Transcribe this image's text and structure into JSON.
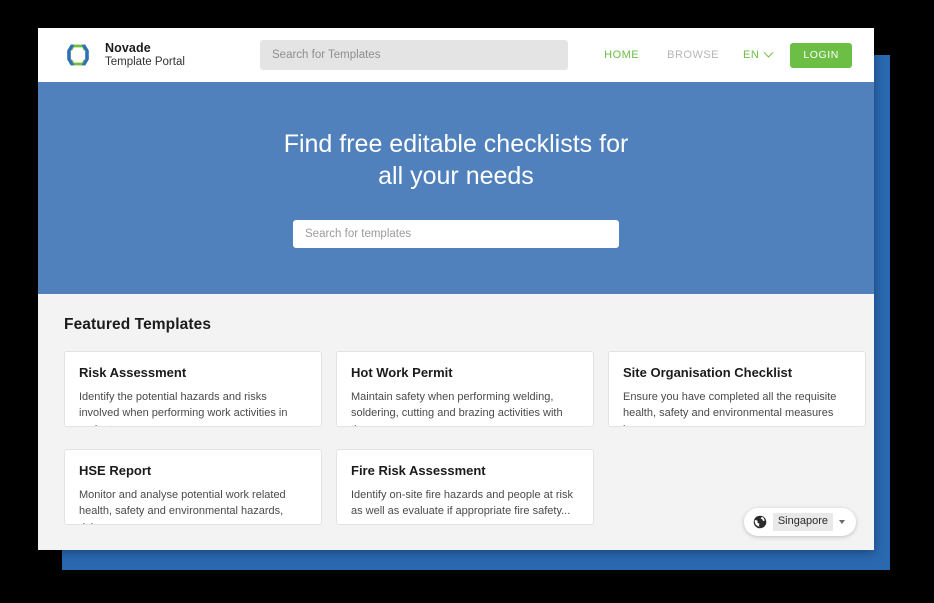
{
  "window": {
    "title": "Novade Template Portal"
  },
  "header": {
    "brand": {
      "name": "Novade",
      "subtitle": "Template Portal",
      "logo_icon": "novade-hexagon-logo",
      "logo_colors": {
        "blue": "#2e6fb7",
        "green": "#74bb44"
      }
    },
    "search": {
      "placeholder": "Search for Templates",
      "value": ""
    },
    "nav": [
      {
        "label": "HOME",
        "state": "active",
        "color": "#6cbe45"
      },
      {
        "label": "BROWSE",
        "state": "muted",
        "color": "#b6b6b6"
      }
    ],
    "language": {
      "label": "EN",
      "icon": "chevron-down-icon",
      "color": "#6cbe45"
    },
    "login_label": "LOGIN",
    "login_color": "#6cbe45"
  },
  "hero": {
    "background_color": "#5081bd",
    "title_line1": "Find free editable checklists for",
    "title_line2": "all your needs",
    "search": {
      "placeholder": "Search for templates",
      "value": ""
    }
  },
  "featured": {
    "heading": "Featured Templates",
    "background_color": "#f3f3f3",
    "cards": [
      {
        "title": "Risk Assessment",
        "description": "Identify the potential hazards and risks involved when performing work activities in projects an..."
      },
      {
        "title": "Hot Work Permit",
        "description": "Maintain safety when performing welding, soldering, cutting and brazing activities with th..."
      },
      {
        "title": "Site Organisation Checklist",
        "description": "Ensure you have completed all the requisite health, safety and environmental measures in..."
      },
      {
        "title": "HSE Report",
        "description": "Monitor and analyse potential work related health, safety and environmental hazards, risk..."
      },
      {
        "title": "Fire Risk Assessment",
        "description": "Identify on-site fire hazards and people at risk as well as evaluate if appropriate fire safety..."
      }
    ]
  },
  "region_selector": {
    "icon": "globe-icon",
    "label": "Singapore",
    "caret_icon": "caret-down-icon"
  },
  "frame": {
    "backdrop_color": "#000000",
    "backplate_color": "#2a68b0"
  }
}
